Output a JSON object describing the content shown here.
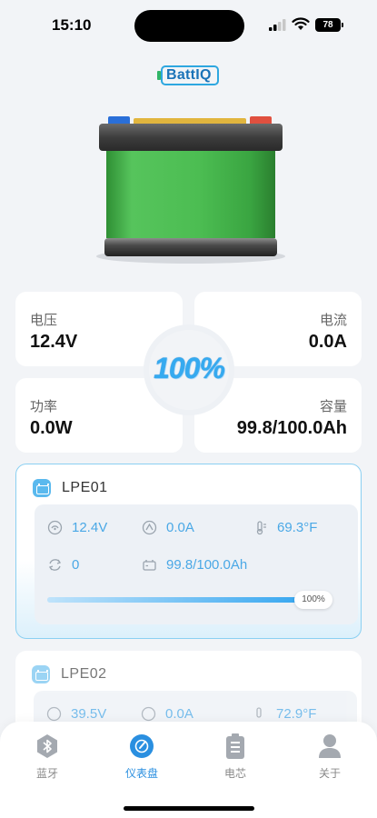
{
  "status_bar": {
    "time": "15:10",
    "battery_level": "78"
  },
  "app": {
    "logo_text": "BattIQ"
  },
  "stats": {
    "voltage_label": "电压",
    "voltage_value": "12.4V",
    "current_label": "电流",
    "current_value": "0.0A",
    "power_label": "功率",
    "power_value": "0.0W",
    "capacity_label": "容量",
    "capacity_value": "99.8/100.0Ah",
    "soc_percent": "100%"
  },
  "devices": [
    {
      "name": "LPE01",
      "voltage": "12.4V",
      "current": "0.0A",
      "temperature": "69.3°F",
      "cycles": "0",
      "capacity": "99.8/100.0Ah",
      "progress_label": "100%",
      "progress_fraction": 1.0
    },
    {
      "name": "LPE02",
      "voltage": "39.5V",
      "current": "0.0A",
      "temperature": "72.9°F"
    }
  ],
  "tabs": [
    {
      "label": "蓝牙",
      "icon": "bluetooth-icon"
    },
    {
      "label": "仪表盘",
      "icon": "dashboard-icon"
    },
    {
      "label": "电芯",
      "icon": "battery-cell-icon"
    },
    {
      "label": "关于",
      "icon": "profile-icon"
    }
  ],
  "colors": {
    "accent": "#2a8fe0",
    "metric_text": "#4aa8e6",
    "battery_green": "#4cc15a"
  }
}
